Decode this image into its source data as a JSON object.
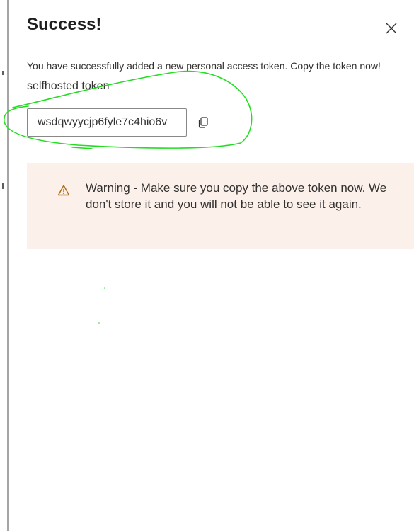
{
  "dialog": {
    "title": "Success!",
    "description": "You have successfully added a new personal access token. Copy the token now!",
    "token_name": "selfhosted token",
    "token_value": "wsdqwyycjp6fyle7c4hio6v",
    "warning_text": "Warning - Make sure you copy the above token now. We don't store it and you will not be able to see it again."
  },
  "icons": {
    "close": "close-icon",
    "copy": "copy-icon",
    "warning": "warning-icon"
  },
  "colors": {
    "warning_background": "#fbf0ea",
    "warning_icon": "#b3670a",
    "annotation_stroke": "#22dd22",
    "text": "#323130"
  }
}
